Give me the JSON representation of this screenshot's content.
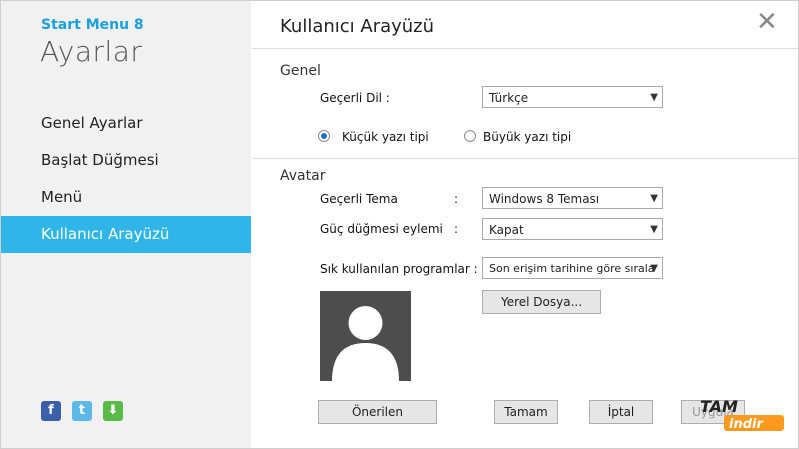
{
  "sidebar": {
    "app_name": "Start Menu 8",
    "heading": "Ayarlar",
    "items": [
      {
        "label": "Genel Ayarlar"
      },
      {
        "label": "Başlat Düğmesi"
      },
      {
        "label": "Menü"
      },
      {
        "label": "Kullanıcı Arayüzü",
        "active": true
      }
    ],
    "social": {
      "facebook": "f",
      "twitter": "t",
      "download": "⬇"
    }
  },
  "main": {
    "title": "Kullanıcı Arayüzü",
    "close_glyph": "✕",
    "general": {
      "section_label": "Genel",
      "language_label": "Geçerli Dil :",
      "language_value": "Türkçe",
      "small_font_label": "Küçük yazı tipi",
      "large_font_label": "Büyük yazı tipi",
      "selected_font": "small"
    },
    "avatar": {
      "section_label": "Avatar",
      "theme_label": "Geçerli Tema",
      "theme_value": "Windows 8 Teması",
      "power_label": "Güç düğmesi eylemi",
      "power_value": "Kapat",
      "programs_label": "Sık kullanılan programlar :",
      "programs_value": "Son erişim tarihine göre sırala",
      "colon": ":",
      "local_file_button": "Yerel Dosya..."
    },
    "footer": {
      "recommended_button": "Önerilen",
      "ok_button": "Tamam",
      "cancel_button": "İptal",
      "apply_button": "Uygula"
    }
  },
  "watermark": {
    "line1": "TAM",
    "line2": "indir"
  },
  "colors": {
    "accent": "#2fb5e8",
    "brand": "#1a9fe0",
    "sidebar_bg": "#f1f1f1"
  }
}
